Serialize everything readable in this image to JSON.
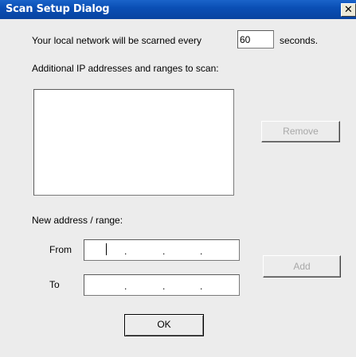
{
  "window": {
    "title": "Scan Setup Dialog",
    "close_glyph": "✕"
  },
  "scan": {
    "prefix_text": "Your local network will be scarned every",
    "interval_value": "60",
    "suffix_text": "seconds."
  },
  "additional": {
    "label": "Additional IP addresses and ranges to scan:",
    "items": [],
    "remove_label": "Remove"
  },
  "new_range": {
    "label": "New address / range:",
    "from_label": "From",
    "to_label": "To",
    "dot": ".",
    "add_label": "Add"
  },
  "footer": {
    "ok_label": "OK"
  }
}
